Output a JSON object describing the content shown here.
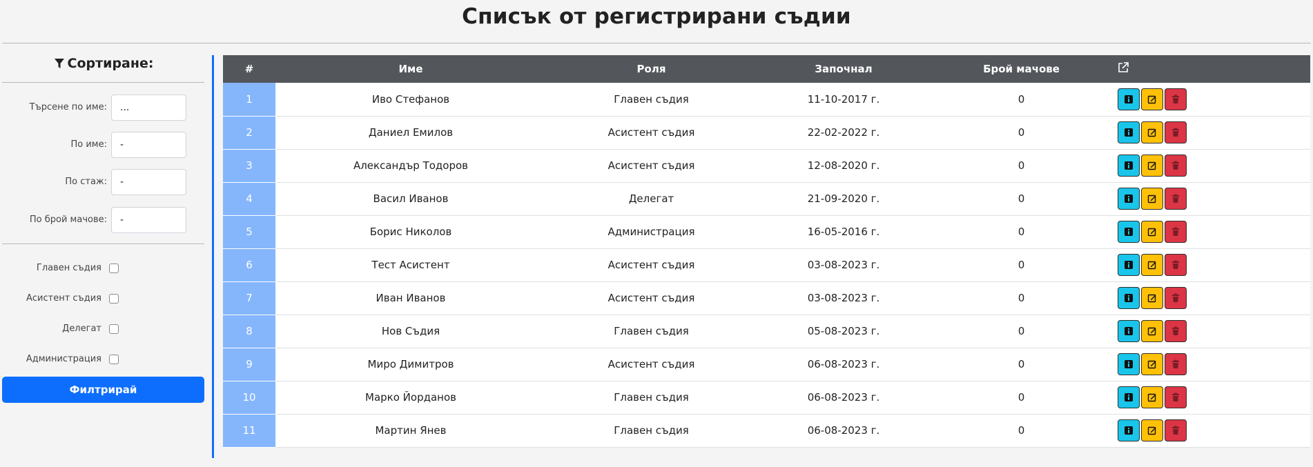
{
  "page": {
    "title": "Списък от регистрирани съдии"
  },
  "sidebar": {
    "sort_title": "Сортиране:",
    "search_label": "Търсене по име:",
    "search_value": "...",
    "by_name_label": "По име:",
    "by_name_value": "-",
    "by_exp_label": "По стаж:",
    "by_exp_value": "-",
    "by_matches_label": "По брой мачове:",
    "by_matches_value": "-",
    "roles": [
      "Главен съдия",
      "Асистент съдия",
      "Делегат",
      "Администрация"
    ],
    "filter_label": "Филтрирай"
  },
  "table": {
    "headers": [
      "#",
      "Име",
      "Роля",
      "Започнал",
      "Брой мачове"
    ],
    "rows": [
      {
        "n": "1",
        "name": "Иво Стефанов",
        "role": "Главен съдия",
        "started": "11-10-2017 г.",
        "matches": "0"
      },
      {
        "n": "2",
        "name": "Даниел Емилов",
        "role": "Асистент съдия",
        "started": "22-02-2022 г.",
        "matches": "0"
      },
      {
        "n": "3",
        "name": "Александър Тодоров",
        "role": "Асистент съдия",
        "started": "12-08-2020 г.",
        "matches": "0"
      },
      {
        "n": "4",
        "name": "Васил Иванов",
        "role": "Делегат",
        "started": "21-09-2020 г.",
        "matches": "0"
      },
      {
        "n": "5",
        "name": "Борис Николов",
        "role": "Администрация",
        "started": "16-05-2016 г.",
        "matches": "0"
      },
      {
        "n": "6",
        "name": "Тест Асистент",
        "role": "Асистент съдия",
        "started": "03-08-2023 г.",
        "matches": "0"
      },
      {
        "n": "7",
        "name": "Иван Иванов",
        "role": "Асистент съдия",
        "started": "03-08-2023 г.",
        "matches": "0"
      },
      {
        "n": "8",
        "name": "Нов Съдия",
        "role": "Главен съдия",
        "started": "05-08-2023 г.",
        "matches": "0"
      },
      {
        "n": "9",
        "name": "Миро Димитров",
        "role": "Асистент съдия",
        "started": "06-08-2023 г.",
        "matches": "0"
      },
      {
        "n": "10",
        "name": "Марко Йорданов",
        "role": "Главен съдия",
        "started": "06-08-2023 г.",
        "matches": "0"
      },
      {
        "n": "11",
        "name": "Мартин Янев",
        "role": "Главен съдия",
        "started": "06-08-2023 г.",
        "matches": "0"
      }
    ],
    "action_icons": [
      "info-icon",
      "edit-icon",
      "trash-icon"
    ],
    "header_icon": "external-link-icon"
  },
  "colors": {
    "primary": "#0d6efd",
    "header_bg": "#53575b",
    "index_bg": "#85b6fc",
    "info": "#19c5ea",
    "edit": "#ffc107",
    "delete": "#dc3545"
  }
}
